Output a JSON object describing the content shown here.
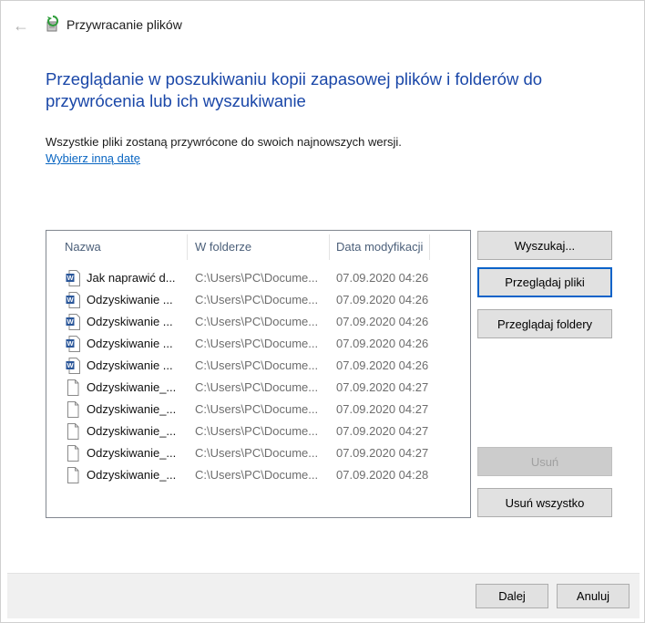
{
  "window": {
    "title": "Przywracanie plików"
  },
  "main": {
    "heading": "Przeglądanie w poszukiwaniu kopii zapasowej plików i folderów do przywrócenia lub ich wyszukiwanie",
    "info": "Wszystkie pliki zostaną przywrócone do swoich najnowszych wersji.",
    "date_link": "Wybierz inną datę"
  },
  "file_list": {
    "columns": {
      "name": "Nazwa",
      "folder": "W folderze",
      "date": "Data modyfikacji"
    },
    "rows": [
      {
        "icon": "word-document-icon",
        "name": "Jak naprawić d...",
        "folder": "C:\\Users\\PC\\Docume...",
        "date": "07.09.2020 04:26"
      },
      {
        "icon": "word-document-icon",
        "name": "Odzyskiwanie ...",
        "folder": "C:\\Users\\PC\\Docume...",
        "date": "07.09.2020 04:26"
      },
      {
        "icon": "word-document-icon",
        "name": "Odzyskiwanie ...",
        "folder": "C:\\Users\\PC\\Docume...",
        "date": "07.09.2020 04:26"
      },
      {
        "icon": "word-document-icon",
        "name": "Odzyskiwanie ...",
        "folder": "C:\\Users\\PC\\Docume...",
        "date": "07.09.2020 04:26"
      },
      {
        "icon": "word-document-icon",
        "name": "Odzyskiwanie ...",
        "folder": "C:\\Users\\PC\\Docume...",
        "date": "07.09.2020 04:26"
      },
      {
        "icon": "blank-file-icon",
        "name": "Odzyskiwanie_...",
        "folder": "C:\\Users\\PC\\Docume...",
        "date": "07.09.2020 04:27"
      },
      {
        "icon": "blank-file-icon",
        "name": "Odzyskiwanie_...",
        "folder": "C:\\Users\\PC\\Docume...",
        "date": "07.09.2020 04:27"
      },
      {
        "icon": "blank-file-icon",
        "name": "Odzyskiwanie_...",
        "folder": "C:\\Users\\PC\\Docume...",
        "date": "07.09.2020 04:27"
      },
      {
        "icon": "blank-file-icon",
        "name": "Odzyskiwanie_...",
        "folder": "C:\\Users\\PC\\Docume...",
        "date": "07.09.2020 04:27"
      },
      {
        "icon": "blank-file-icon",
        "name": "Odzyskiwanie_...",
        "folder": "C:\\Users\\PC\\Docume...",
        "date": "07.09.2020 04:28"
      }
    ]
  },
  "buttons": {
    "search": "Wyszukaj...",
    "browse_files": "Przeglądaj pliki",
    "browse_folders": "Przeglądaj foldery",
    "remove": "Usuń",
    "remove_all": "Usuń wszystko",
    "next": "Dalej",
    "cancel": "Anuluj"
  },
  "colors": {
    "heading": "#1a47a8",
    "link": "#0a66c2",
    "focus": "#0a63c9"
  }
}
